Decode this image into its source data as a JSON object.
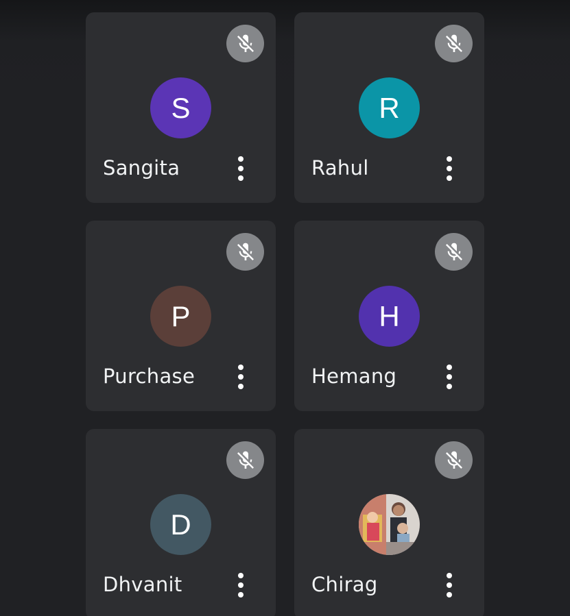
{
  "participants": [
    {
      "name": "Sangita",
      "initial": "S",
      "avatar_color": "#5b35b5",
      "muted": true,
      "photo": false
    },
    {
      "name": "Rahul",
      "initial": "R",
      "avatar_color": "#0b95a7",
      "muted": true,
      "photo": false
    },
    {
      "name": "Purchase",
      "initial": "P",
      "avatar_color": "#5b3f39",
      "muted": true,
      "photo": false
    },
    {
      "name": "Hemang",
      "initial": "H",
      "avatar_color": "#5232ae",
      "muted": true,
      "photo": false
    },
    {
      "name": "Dhvanit",
      "initial": "D",
      "avatar_color": "#435863",
      "muted": true,
      "photo": false
    },
    {
      "name": "Chirag",
      "initial": "",
      "avatar_color": "",
      "muted": true,
      "photo": true
    }
  ],
  "icons": {
    "mute": "mic-off-icon",
    "more": "more-vert-icon"
  },
  "colors": {
    "background": "#202124",
    "tile": "#2d2e31",
    "mute_badge": "#85878a",
    "name_text": "#f1f3f4"
  }
}
